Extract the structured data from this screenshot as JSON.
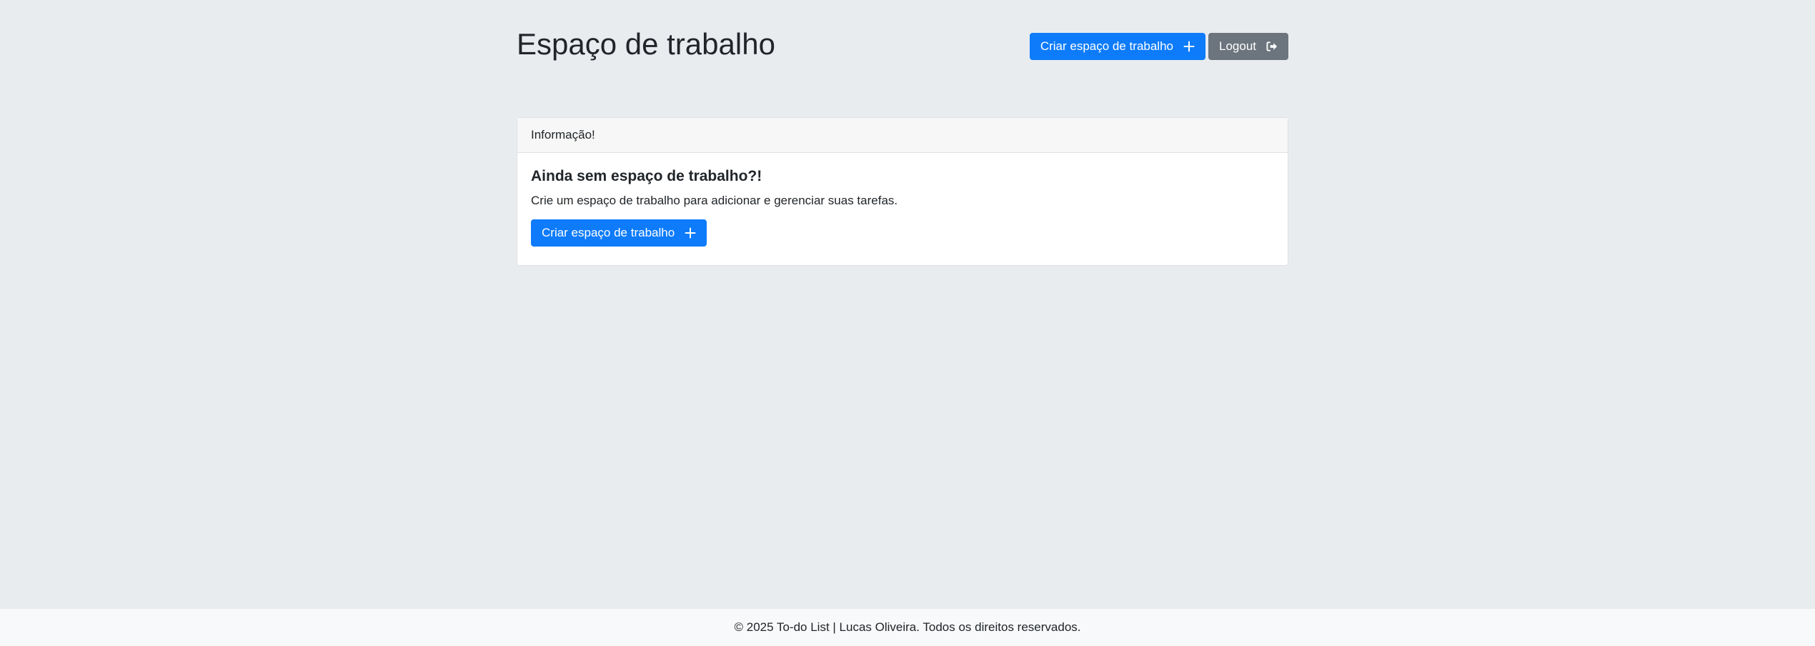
{
  "header": {
    "title": "Espaço de trabalho",
    "create_button_label": "Criar espaço de trabalho",
    "create_button_icon": "plus-icon",
    "logout_button_label": "Logout",
    "logout_button_icon": "sign-out-icon"
  },
  "card": {
    "header_text": "Informação!",
    "title": "Ainda sem espaço de trabalho?!",
    "text": "Crie um espaço de trabalho para adicionar e gerenciar suas tarefas.",
    "button_label": "Criar espaço de trabalho",
    "button_icon": "plus-icon"
  },
  "footer": {
    "text": "© 2025 To-do List | Lucas Oliveira. Todos os direitos reservados."
  },
  "colors": {
    "background": "#e9ecef",
    "primary": "#0d7bfa",
    "secondary": "#6c757d",
    "footer_background": "#f8f9fa"
  }
}
